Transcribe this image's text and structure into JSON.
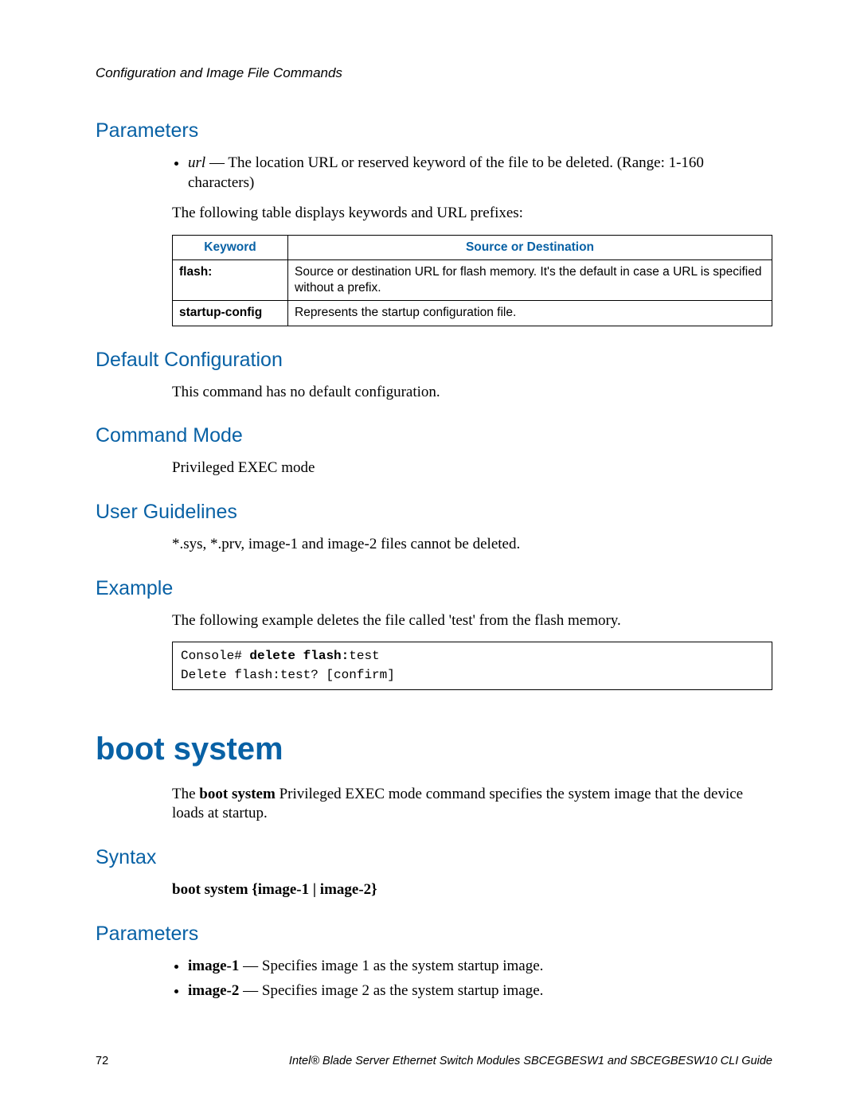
{
  "header": {
    "text": "Configuration and Image File Commands"
  },
  "sections": {
    "parameters1": {
      "heading": "Parameters",
      "bullet_prefix_italic": "url",
      "bullet_text": " — The location URL or reserved keyword of the file to be deleted. (Range: 1-160 characters)",
      "table_intro": "The following table displays keywords and URL prefixes:"
    },
    "table": {
      "h1": "Keyword",
      "h2": "Source or Destination",
      "rows": [
        {
          "k": "flash:",
          "d": "Source or destination URL for flash memory. It's the default in case a URL is specified without a prefix."
        },
        {
          "k": "startup-config",
          "d": "Represents the startup configuration file."
        }
      ]
    },
    "default_config": {
      "heading": "Default Configuration",
      "text": "This command has no default configuration."
    },
    "command_mode": {
      "heading": "Command Mode",
      "text": "Privileged EXEC mode"
    },
    "user_guidelines": {
      "heading": "User Guidelines",
      "text": "*.sys, *.prv, image-1 and image-2 files cannot be deleted."
    },
    "example": {
      "heading": "Example",
      "text": "The following example deletes the file called 'test' from the flash memory.",
      "code_prefix": "Console# ",
      "code_bold": "delete flash:",
      "code_suffix": "test",
      "code_line2": "Delete flash:test? [confirm]"
    },
    "boot_system": {
      "heading": "boot system",
      "intro_prefix": "The ",
      "intro_bold": "boot system",
      "intro_suffix": " Privileged EXEC mode command specifies the system image that the device loads at startup."
    },
    "syntax": {
      "heading": "Syntax",
      "line": "boot system {image-1 | image-2}"
    },
    "parameters2": {
      "heading": "Parameters",
      "items": [
        {
          "bold": "image-1",
          "rest": " — Specifies image 1 as the system startup image."
        },
        {
          "bold": "image-2",
          "rest": " — Specifies image 2 as the system startup image."
        }
      ]
    }
  },
  "footer": {
    "page": "72",
    "title": "Intel® Blade Server Ethernet Switch Modules SBCEGBESW1 and SBCEGBESW10 CLI Guide"
  }
}
